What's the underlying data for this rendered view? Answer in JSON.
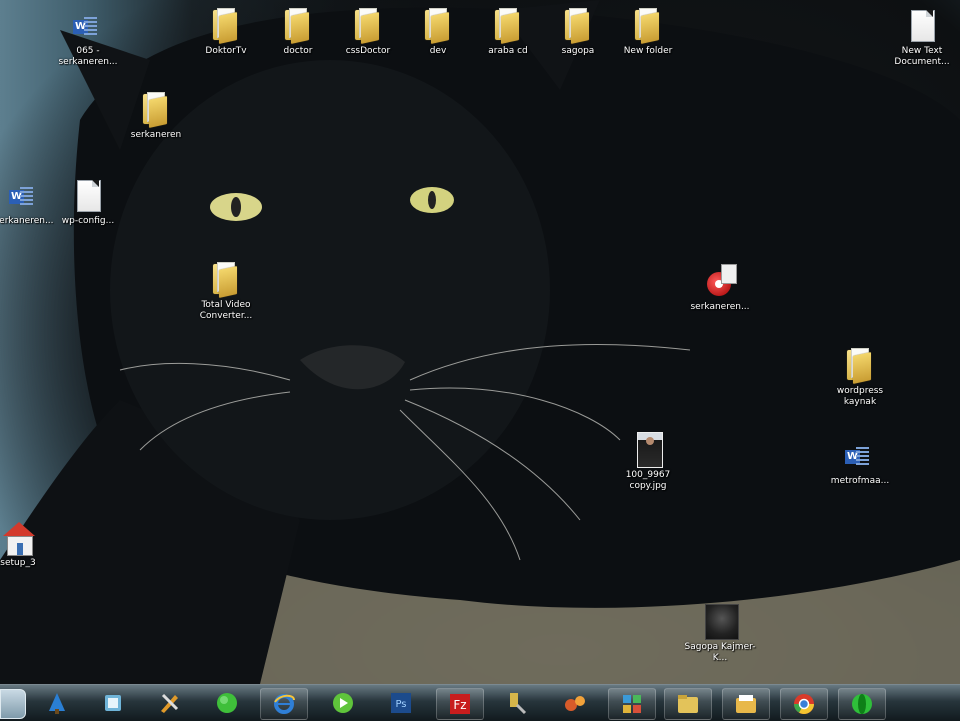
{
  "desktop_icons": [
    {
      "id": "doc-065",
      "type": "word",
      "label": "065 - serkaneren..."
    },
    {
      "id": "doktortv",
      "type": "folder",
      "label": "DoktorTv"
    },
    {
      "id": "doctor",
      "type": "folder",
      "label": "doctor"
    },
    {
      "id": "cssdoctor",
      "type": "folder",
      "label": "cssDoctor"
    },
    {
      "id": "dev",
      "type": "folder",
      "label": "dev"
    },
    {
      "id": "araba-cd",
      "type": "folder",
      "label": "araba cd"
    },
    {
      "id": "sagopa",
      "type": "folder",
      "label": "sagopa"
    },
    {
      "id": "new-folder",
      "type": "folder",
      "label": "New folder"
    },
    {
      "id": "new-text-doc",
      "type": "doc",
      "label": "New Text Document..."
    },
    {
      "id": "serkaneren-folder",
      "type": "folder",
      "label": "serkaneren"
    },
    {
      "id": "serkaneren-word",
      "type": "word",
      "label": "serkaneren..."
    },
    {
      "id": "wp-config",
      "type": "doc",
      "label": "wp-config..."
    },
    {
      "id": "total-video",
      "type": "folder",
      "label": "Total Video Converter..."
    },
    {
      "id": "serkaneren-app",
      "type": "app-red",
      "label": "serkaneren..."
    },
    {
      "id": "wordpress-kaynak",
      "type": "folder",
      "label": "wordpress kaynak"
    },
    {
      "id": "photo-100-9967",
      "type": "photo",
      "label": "100_9967 copy.jpg"
    },
    {
      "id": "metrofmaa",
      "type": "word",
      "label": "metrofmaa..."
    },
    {
      "id": "setup-app",
      "type": "app-house",
      "label": "setup_3"
    },
    {
      "id": "sagopa-kajmer",
      "type": "app-dark",
      "label": "Sagopa Kajmer-K..."
    }
  ],
  "taskbar": {
    "items": [
      {
        "id": "start",
        "icon": "start-orb-icon"
      },
      {
        "id": "tb-1",
        "icon": "tree-app-icon",
        "color": "#2a7fd4"
      },
      {
        "id": "tb-2",
        "icon": "book-app-icon",
        "color": "#6fb4d8"
      },
      {
        "id": "tb-3",
        "icon": "tools-app-icon",
        "color": "#e09a2a"
      },
      {
        "id": "tb-4",
        "icon": "green-circle-icon",
        "color": "#3fbf3a"
      },
      {
        "id": "tb-5",
        "icon": "internet-explorer-icon",
        "color": "#2f7fd6"
      },
      {
        "id": "tb-6",
        "icon": "media-player-icon",
        "color": "#5fc43b"
      },
      {
        "id": "tb-7",
        "icon": "photoshop-icon",
        "color": "#1c4b8c",
        "text": "Ps"
      },
      {
        "id": "tb-8",
        "icon": "filezilla-icon",
        "color": "#c81d1d",
        "text": "Fz"
      },
      {
        "id": "tb-9",
        "icon": "utility-icon",
        "color": "#d7b64a"
      },
      {
        "id": "tb-10",
        "icon": "network-icon",
        "color": "#d75b2a"
      },
      {
        "id": "tb-11",
        "icon": "control-panel-icon",
        "color": "#3a9ad8"
      },
      {
        "id": "tb-12",
        "icon": "explorer-folder-icon",
        "color": "#e3c35a"
      },
      {
        "id": "tb-13",
        "icon": "folder-icon",
        "color": "#e8b84a"
      },
      {
        "id": "tb-14",
        "icon": "chrome-icon",
        "color": "#d93a2a"
      },
      {
        "id": "tb-15",
        "icon": "green-orb-icon",
        "color": "#2fbf3a"
      }
    ]
  }
}
